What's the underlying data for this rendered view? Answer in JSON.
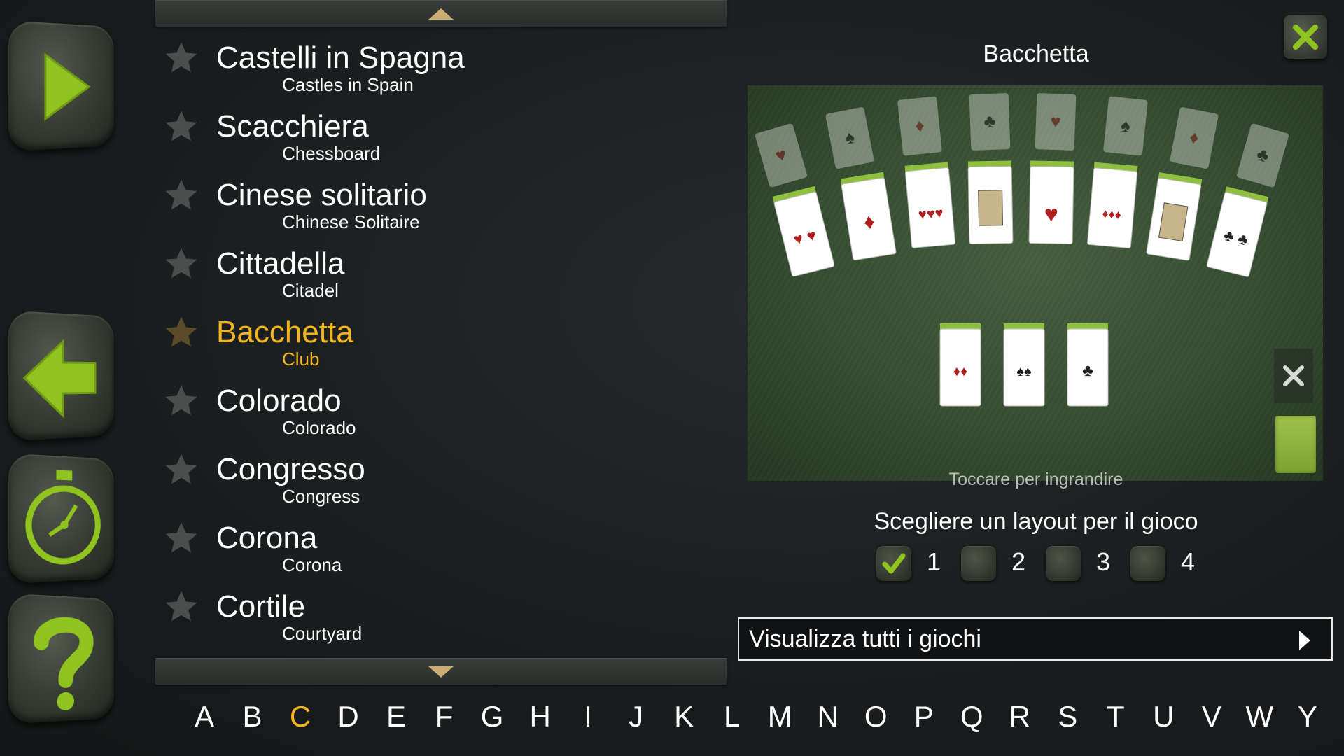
{
  "sidebar": {
    "buttons": [
      {
        "name": "play",
        "icon": "play-icon"
      },
      {
        "name": "back",
        "icon": "back-arrow-icon"
      },
      {
        "name": "timer",
        "icon": "stopwatch-icon"
      },
      {
        "name": "help",
        "icon": "question-mark-icon"
      }
    ]
  },
  "games": [
    {
      "title": "Castelli in Spagna",
      "subtitle": "Castles in Spain",
      "selected": false
    },
    {
      "title": "Scacchiera",
      "subtitle": "Chessboard",
      "selected": false
    },
    {
      "title": "Cinese solitario",
      "subtitle": "Chinese Solitaire",
      "selected": false
    },
    {
      "title": "Cittadella",
      "subtitle": "Citadel",
      "selected": false
    },
    {
      "title": "Bacchetta",
      "subtitle": "Club",
      "selected": true
    },
    {
      "title": "Colorado",
      "subtitle": "Colorado",
      "selected": false
    },
    {
      "title": "Congresso",
      "subtitle": "Congress",
      "selected": false
    },
    {
      "title": "Corona",
      "subtitle": "Corona",
      "selected": false
    },
    {
      "title": "Cortile",
      "subtitle": "Courtyard",
      "selected": false
    }
  ],
  "alphabet": {
    "letters": [
      "A",
      "B",
      "C",
      "D",
      "E",
      "F",
      "G",
      "H",
      "I",
      "J",
      "K",
      "L",
      "M",
      "N",
      "O",
      "P",
      "Q",
      "R",
      "S",
      "T",
      "U",
      "V",
      "W",
      "Y"
    ],
    "active": "C"
  },
  "preview": {
    "title": "Bacchetta",
    "hint": "Toccare per ingrandire"
  },
  "layout": {
    "prompt": "Scegliere un layout per il gioco",
    "options": [
      "1",
      "2",
      "3",
      "4"
    ],
    "selected": "1"
  },
  "view_all": {
    "label": "Visualizza tutti i giochi"
  },
  "colors": {
    "accent": "#f3b51c",
    "icon_green": "#8fc31f",
    "background": "#1b1e1f",
    "felt": "#3f5838"
  }
}
